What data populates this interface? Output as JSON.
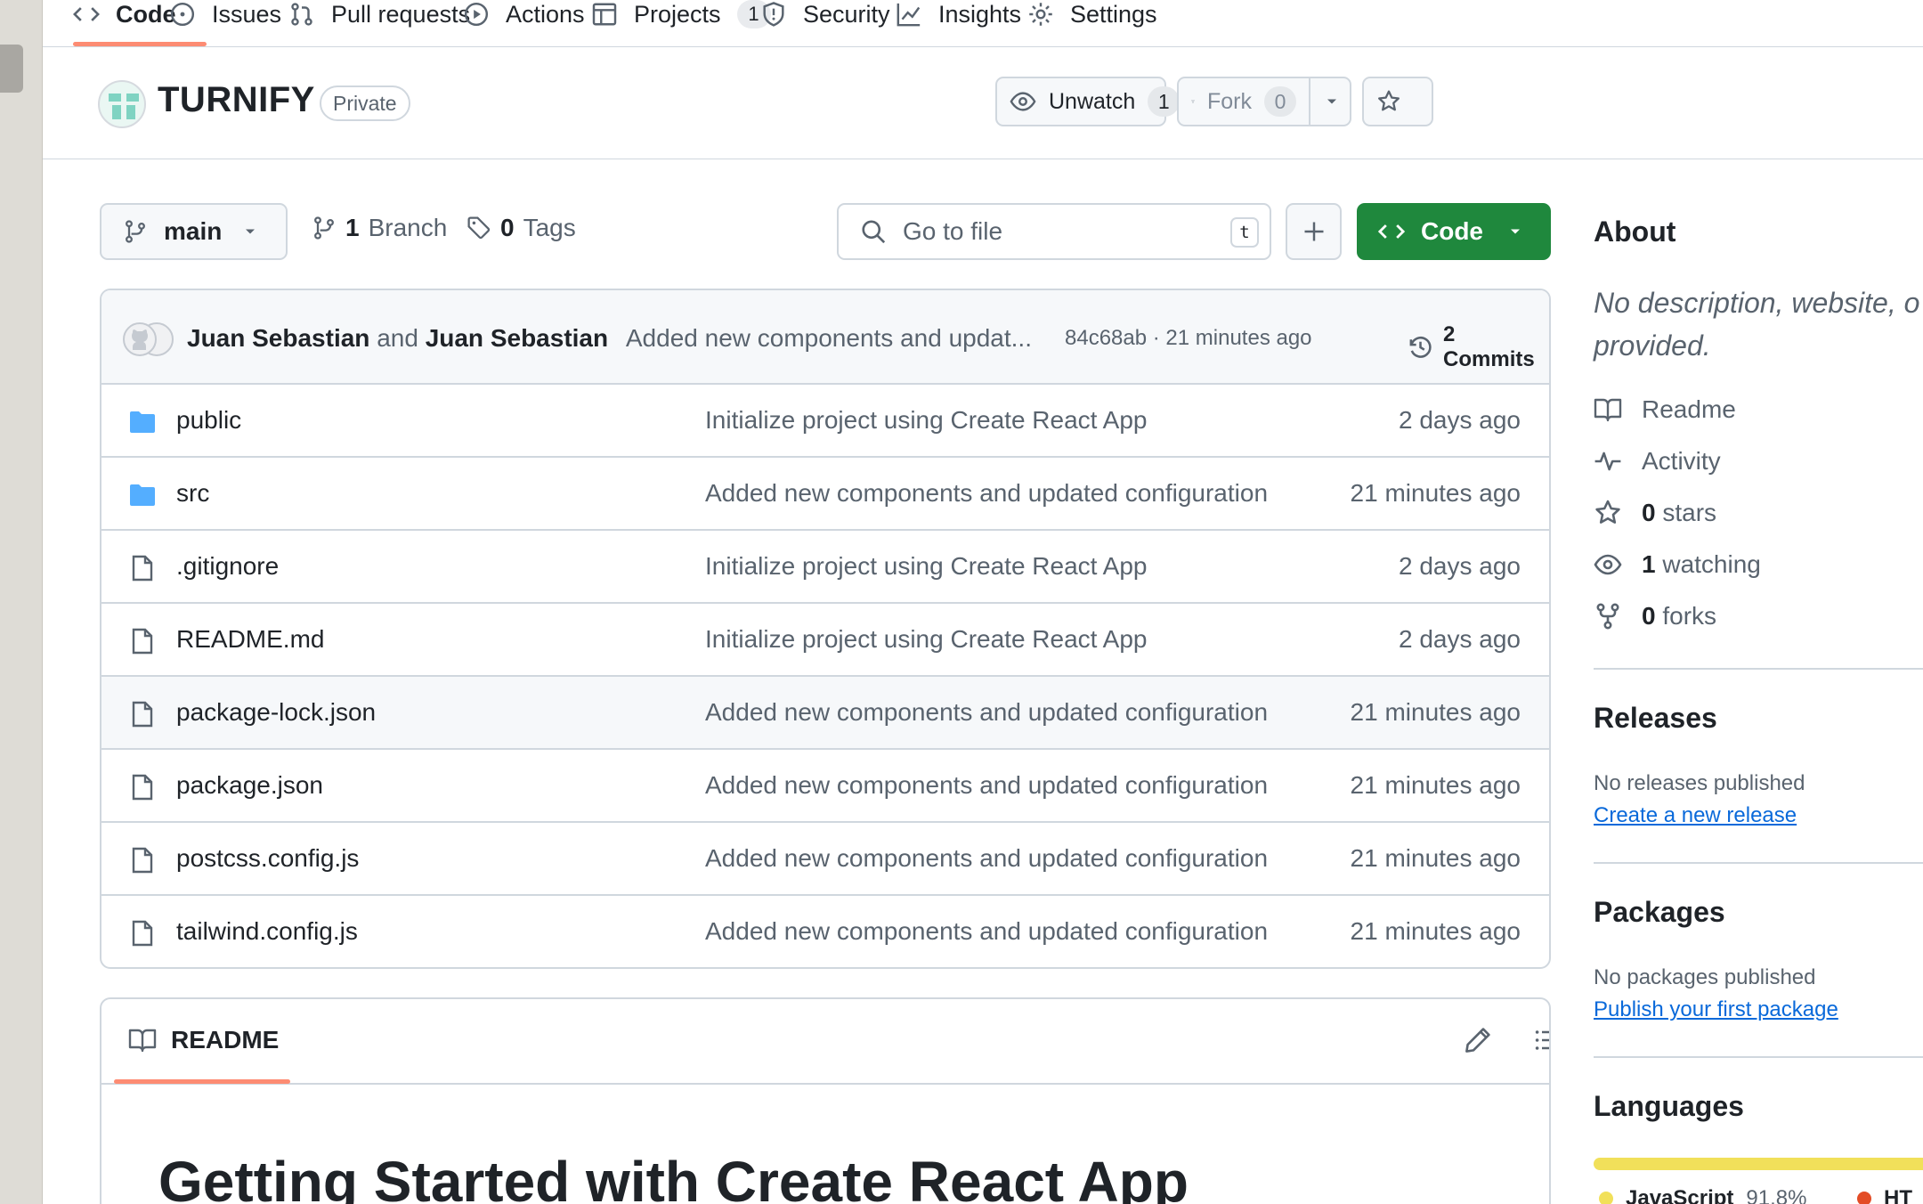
{
  "tabs": [
    {
      "label": "Code",
      "icon": "code-icon",
      "active": true
    },
    {
      "label": "Issues",
      "icon": "issue-icon"
    },
    {
      "label": "Pull requests",
      "icon": "pull-request-icon"
    },
    {
      "label": "Actions",
      "icon": "play-icon"
    },
    {
      "label": "Projects",
      "icon": "table-icon",
      "count": "1"
    },
    {
      "label": "Security",
      "icon": "shield-icon"
    },
    {
      "label": "Insights",
      "icon": "graph-icon"
    },
    {
      "label": "Settings",
      "icon": "gear-icon"
    }
  ],
  "repo": {
    "name": "TURNIFY",
    "visibility": "Private",
    "watch_label": "Unwatch",
    "watch_count": "1",
    "fork_label": "Fork",
    "fork_count": "0"
  },
  "toolbar": {
    "branch": "main",
    "branch_count": "1",
    "branch_label": "Branch",
    "tag_count": "0",
    "tag_label": "Tags",
    "search_placeholder": "Go to file",
    "search_shortcut": "t",
    "code_label": "Code"
  },
  "commit": {
    "author1": "Juan Sebastian",
    "and": "and",
    "author2": "Juan Sebastian",
    "message": "Added new components and updat...",
    "sha_time": "84c68ab · 21 minutes ago",
    "commits_label": "2 Commits"
  },
  "files": [
    {
      "name": "public",
      "type": "folder",
      "message": "Initialize project using Create React App",
      "age": "2 days ago"
    },
    {
      "name": "src",
      "type": "folder",
      "message": "Added new components and updated configuration",
      "age": "21 minutes ago"
    },
    {
      "name": ".gitignore",
      "type": "file",
      "message": "Initialize project using Create React App",
      "age": "2 days ago"
    },
    {
      "name": "README.md",
      "type": "file",
      "message": "Initialize project using Create React App",
      "age": "2 days ago"
    },
    {
      "name": "package-lock.json",
      "type": "file",
      "message": "Added new components and updated configuration",
      "age": "21 minutes ago"
    },
    {
      "name": "package.json",
      "type": "file",
      "message": "Added new components and updated configuration",
      "age": "21 minutes ago"
    },
    {
      "name": "postcss.config.js",
      "type": "file",
      "message": "Added new components and updated configuration",
      "age": "21 minutes ago"
    },
    {
      "name": "tailwind.config.js",
      "type": "file",
      "message": "Added new components and updated configuration",
      "age": "21 minutes ago"
    }
  ],
  "readme": {
    "tab_label": "README",
    "heading": "Getting Started with Create React App"
  },
  "about": {
    "title": "About",
    "description_line1": "No description, website, o",
    "description_line2": "provided.",
    "readme": "Readme",
    "activity": "Activity",
    "stars_count": "0",
    "stars_label": "stars",
    "watching_count": "1",
    "watching_label": "watching",
    "forks_count": "0",
    "forks_label": "forks"
  },
  "releases": {
    "title": "Releases",
    "note": "No releases published",
    "link": "Create a new release"
  },
  "packages": {
    "title": "Packages",
    "note": "No packages published",
    "link": "Publish your first package"
  },
  "languages": {
    "title": "Languages",
    "items": [
      {
        "name": "JavaScript",
        "percent": "91.8%",
        "color": "#f1e05a"
      },
      {
        "name": "HT",
        "percent": "",
        "color": "#e34c26"
      }
    ]
  },
  "colors": {
    "accent_underline": "#fd8c73",
    "code_button": "#1f883d",
    "link": "#0969da",
    "folder": "#54aeff"
  }
}
